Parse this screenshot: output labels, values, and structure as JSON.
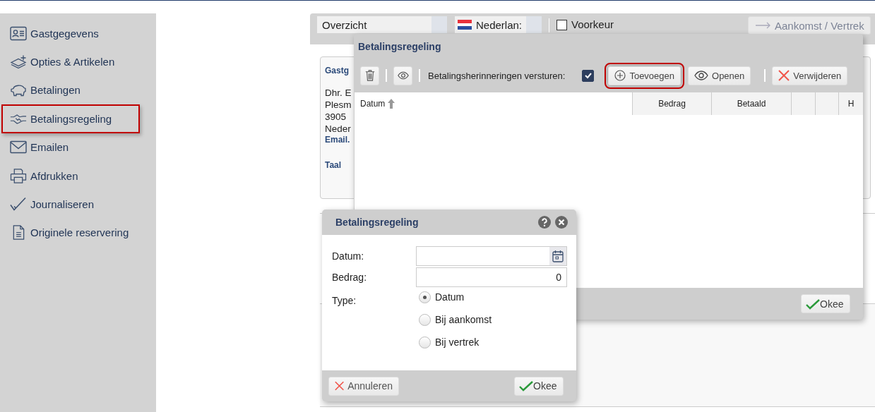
{
  "sidebar": {
    "items": [
      {
        "label": "Gastgegevens",
        "highlighted": false
      },
      {
        "label": "Opties & Artikelen",
        "highlighted": false
      },
      {
        "label": "Betalingen",
        "highlighted": false
      },
      {
        "label": "Betalingsregeling",
        "highlighted": true
      },
      {
        "label": "Emailen",
        "highlighted": false
      },
      {
        "label": "Afdrukken",
        "highlighted": false
      },
      {
        "label": "Journaliseren",
        "highlighted": false
      },
      {
        "label": "Originele reservering",
        "highlighted": false
      }
    ]
  },
  "toolbar": {
    "view_select": {
      "value": "Overzicht"
    },
    "language_select": {
      "value": "Nederlan:"
    },
    "preference": {
      "label": "Voorkeur",
      "checked": false
    },
    "arrival_button": {
      "label": "Aankomst / Vertrek"
    }
  },
  "guest_card": {
    "heading": "Gastg",
    "lines": [
      "Dhr. E",
      "Plesm",
      "3905",
      "Neder"
    ],
    "email_label": "Email.",
    "language_label": "Taal"
  },
  "schedule_dialog": {
    "title": "Betalingsregeling",
    "reminders": {
      "label": "Betalingsherinneringen versturen:",
      "checked": true
    },
    "buttons": [
      {
        "label": "Toevoegen",
        "kind": "add",
        "highlighted": true
      },
      {
        "label": "Openen",
        "kind": "open",
        "highlighted": false
      },
      {
        "label": "Verwijderen",
        "kind": "delete",
        "highlighted": false
      }
    ],
    "table": {
      "columns": [
        {
          "label": "Datum",
          "sorted": true
        },
        {
          "label": "Bedrag",
          "sorted": false
        },
        {
          "label": "Betaald",
          "sorted": false
        },
        {
          "sorted": false
        },
        {
          "sorted": false
        },
        {
          "label": "H",
          "sorted": false
        }
      ]
    },
    "ok_button": "Okee"
  },
  "entry_dialog": {
    "title": "Betalingsregeling",
    "fields": [
      {
        "label": "Datum:",
        "kind": "date"
      },
      {
        "label": "Bedrag:",
        "kind": "number",
        "value": "0"
      }
    ],
    "type": {
      "label": "Type:",
      "options": [
        {
          "label": "Datum",
          "selected": true
        },
        {
          "label": "Bij aankomst",
          "selected": false
        },
        {
          "label": "Bij vertrek",
          "selected": false
        }
      ]
    },
    "cancel_button": "Annuleren",
    "ok_button": "Okee"
  }
}
